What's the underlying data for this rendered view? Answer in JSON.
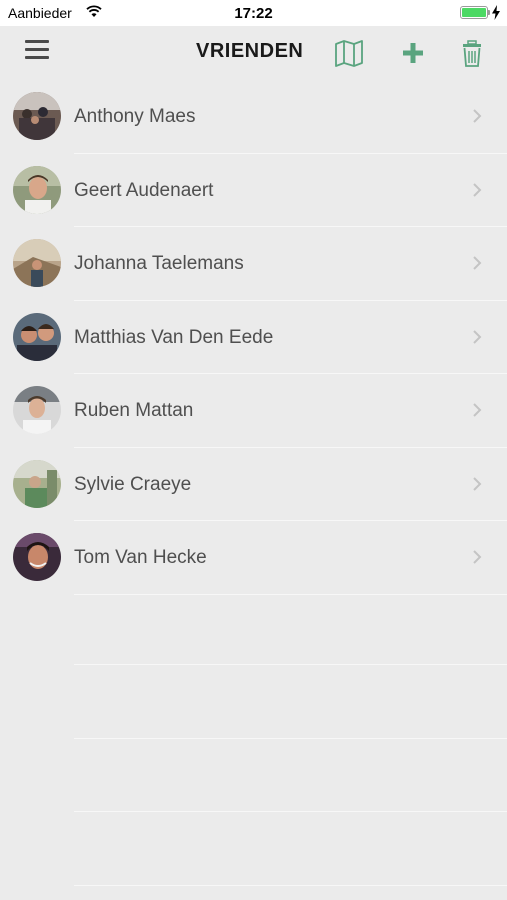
{
  "status_bar": {
    "carrier": "Aanbieder",
    "time": "17:22",
    "battery_level": 1.0,
    "icons": [
      "wifi-icon",
      "battery-icon",
      "charging-icon"
    ]
  },
  "nav": {
    "title": "VRIENDEN",
    "icons": [
      "hamburger-menu-icon",
      "map-icon",
      "plus-icon",
      "trash-icon"
    ],
    "accent_color": "#5aa47f"
  },
  "friends": [
    {
      "name": "Anthony Maes"
    },
    {
      "name": "Geert Audenaert"
    },
    {
      "name": "Johanna Taelemans"
    },
    {
      "name": "Matthias Van Den Eede"
    },
    {
      "name": "Ruben Mattan"
    },
    {
      "name": "Sylvie Craeye"
    },
    {
      "name": "Tom Van Hecke"
    }
  ]
}
